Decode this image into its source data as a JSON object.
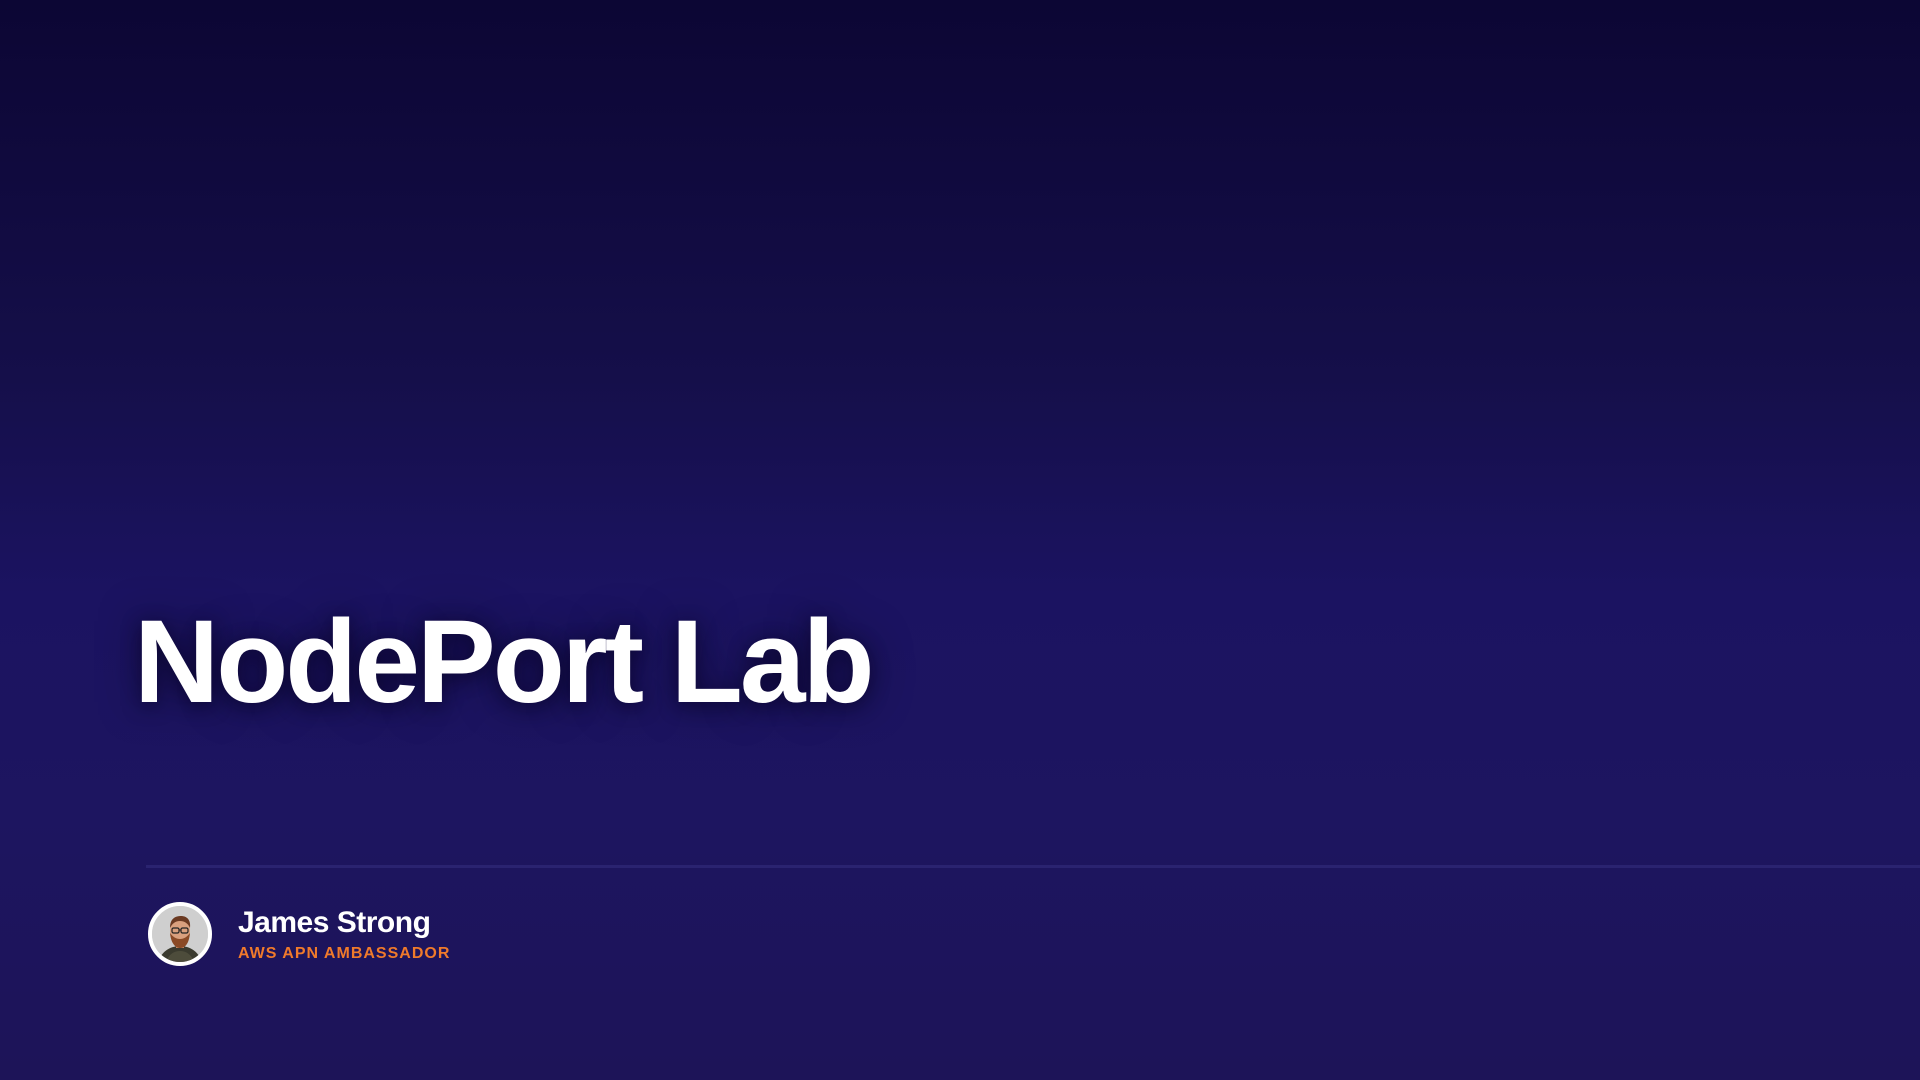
{
  "slide": {
    "title": "NodePort Lab"
  },
  "presenter": {
    "name": "James Strong",
    "role": "AWS APN AMBASSADOR"
  },
  "colors": {
    "background_top": "#0c0634",
    "background_bottom": "#1d1458",
    "title": "#ffffff",
    "role_accent": "#f07a2b",
    "divider": "#2a2370"
  }
}
